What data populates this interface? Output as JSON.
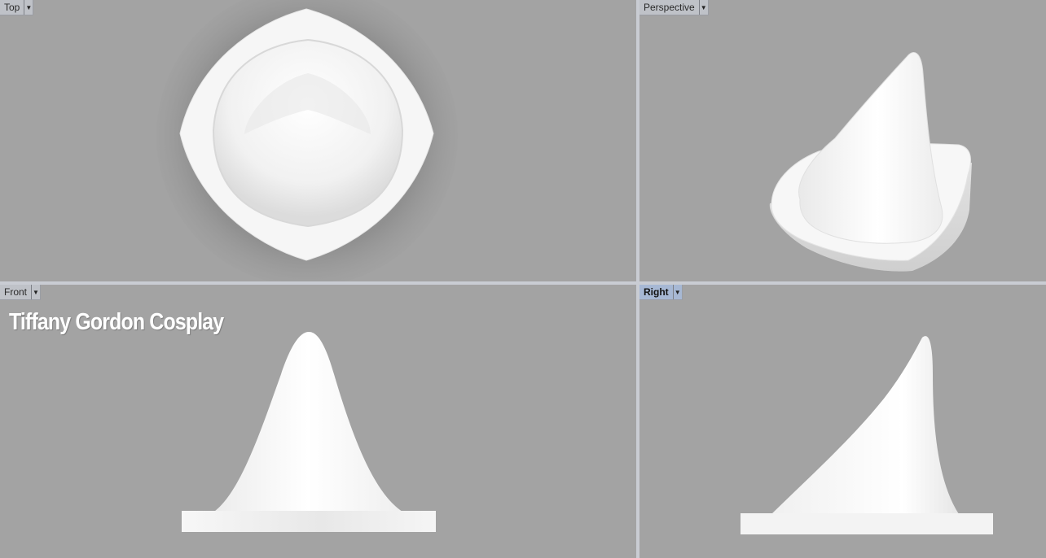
{
  "viewports": {
    "top": {
      "label": "Top"
    },
    "perspective": {
      "label": "Perspective"
    },
    "front": {
      "label": "Front"
    },
    "right": {
      "label": "Right",
      "active": true
    }
  },
  "watermark": "Tiffany Gordon Cosplay",
  "colors": {
    "viewport_background": "#a3a3a3",
    "viewport_border": "#c9ccd3",
    "model": "#f4f4f4",
    "active_tab": "#a7b8d4",
    "inactive_tab": "#bfc2c8"
  }
}
